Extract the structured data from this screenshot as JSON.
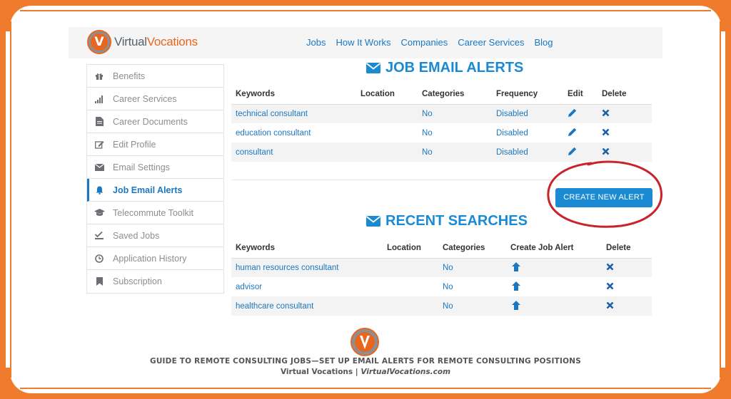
{
  "header": {
    "logo": {
      "part1": "Virtual",
      "part2": "Vocations",
      "mark": "V"
    },
    "nav": [
      "Jobs",
      "How It Works",
      "Companies",
      "Career Services",
      "Blog"
    ]
  },
  "sidebar": {
    "items": [
      {
        "label": "Benefits",
        "icon": "gift-icon"
      },
      {
        "label": "Career Services",
        "icon": "signal-bars-icon"
      },
      {
        "label": "Career Documents",
        "icon": "document-icon"
      },
      {
        "label": "Edit Profile",
        "icon": "edit-icon"
      },
      {
        "label": "Email Settings",
        "icon": "envelope-icon"
      },
      {
        "label": "Job Email Alerts",
        "icon": "bell-icon",
        "active": true
      },
      {
        "label": "Telecommute Toolkit",
        "icon": "graduation-cap-icon"
      },
      {
        "label": "Saved Jobs",
        "icon": "check-icon"
      },
      {
        "label": "Application History",
        "icon": "clock-icon"
      },
      {
        "label": "Subscription",
        "icon": "bookmark-icon"
      }
    ]
  },
  "alerts": {
    "title": "JOB EMAIL ALERTS",
    "columns": [
      "Keywords",
      "Location",
      "Categories",
      "Frequency",
      "Edit",
      "Delete"
    ],
    "rows": [
      {
        "keywords": "technical consultant",
        "location": "",
        "categories": "No",
        "frequency": "Disabled"
      },
      {
        "keywords": "education consultant",
        "location": "",
        "categories": "No",
        "frequency": "Disabled"
      },
      {
        "keywords": "consultant",
        "location": "",
        "categories": "No",
        "frequency": "Disabled"
      }
    ],
    "create_button": "CREATE NEW ALERT"
  },
  "searches": {
    "title": "RECENT SEARCHES",
    "columns": [
      "Keywords",
      "Location",
      "Categories",
      "Create Job Alert",
      "Delete"
    ],
    "rows": [
      {
        "keywords": "human resources consultant",
        "location": "",
        "categories": "No"
      },
      {
        "keywords": "advisor",
        "location": "",
        "categories": "No"
      },
      {
        "keywords": "healthcare consultant",
        "location": "",
        "categories": "No"
      }
    ]
  },
  "footer": {
    "line1": "GUIDE TO REMOTE CONSULTING JOBS—SET UP EMAIL ALERTS FOR REMOTE CONSULTING POSITIONS",
    "line2_a": "Virtual Vocations | ",
    "line2_b": "VirtualVocations.com"
  },
  "colors": {
    "accent": "#1a8ad3",
    "link": "#1a78c2",
    "frame": "#f07b2d",
    "highlight_circle": "#c8242c"
  }
}
